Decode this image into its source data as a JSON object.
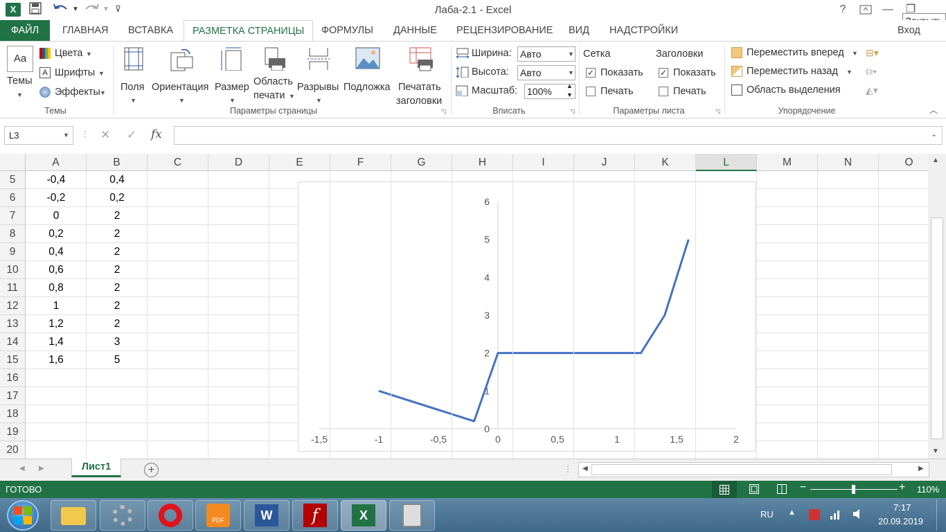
{
  "window": {
    "title": "Лаба-2.1 - Excel",
    "help": "?",
    "tooltip": "Закрыть",
    "login": "Вход"
  },
  "tabs": [
    {
      "label": "ФАЙЛ"
    },
    {
      "label": "ГЛАВНАЯ"
    },
    {
      "label": "ВСТАВКА"
    },
    {
      "label": "РАЗМЕТКА СТРАНИЦЫ"
    },
    {
      "label": "ФОРМУЛЫ"
    },
    {
      "label": "ДАННЫЕ"
    },
    {
      "label": "РЕЦЕНЗИРОВАНИЕ"
    },
    {
      "label": "ВИД"
    },
    {
      "label": "НАДСТРОЙКИ"
    }
  ],
  "ribbon": {
    "themes": {
      "label": "Темы",
      "colors": "Цвета",
      "fonts": "Шрифты",
      "effects": "Эффекты",
      "group": "Темы"
    },
    "page_setup": {
      "margins": "Поля",
      "orientation": "Ориентация",
      "size": "Размер",
      "print_area_1": "Область",
      "print_area_2": "печати",
      "breaks": "Разрывы",
      "background": "Подложка",
      "print_titles_1": "Печатать",
      "print_titles_2": "заголовки",
      "group": "Параметры страницы"
    },
    "fit": {
      "width_label": "Ширина:",
      "width_value": "Авто",
      "height_label": "Высота:",
      "height_value": "Авто",
      "scale_label": "Масштаб:",
      "scale_value": "100%",
      "group": "Вписать"
    },
    "sheet_options": {
      "gridlines": "Сетка",
      "headings": "Заголовки",
      "show": "Показать",
      "print": "Печать",
      "group": "Параметры листа"
    },
    "arrange": {
      "bring_forward": "Переместить вперед",
      "send_backward": "Переместить назад",
      "selection_pane": "Область выделения",
      "group": "Упорядочение"
    }
  },
  "formula_bar": {
    "name_box": "L3",
    "fx": "fx",
    "formula": ""
  },
  "columns": [
    "A",
    "B",
    "C",
    "D",
    "E",
    "F",
    "G",
    "H",
    "I",
    "J",
    "K",
    "L",
    "M",
    "N",
    "O"
  ],
  "active_column": "L",
  "rows": [
    {
      "n": "5",
      "a": "-0,4",
      "b": "0,4"
    },
    {
      "n": "6",
      "a": "-0,2",
      "b": "0,2"
    },
    {
      "n": "7",
      "a": "0",
      "b": "2"
    },
    {
      "n": "8",
      "a": "0,2",
      "b": "2"
    },
    {
      "n": "9",
      "a": "0,4",
      "b": "2"
    },
    {
      "n": "10",
      "a": "0,6",
      "b": "2"
    },
    {
      "n": "11",
      "a": "0,8",
      "b": "2"
    },
    {
      "n": "12",
      "a": "1",
      "b": "2"
    },
    {
      "n": "13",
      "a": "1,2",
      "b": "2"
    },
    {
      "n": "14",
      "a": "1,4",
      "b": "3"
    },
    {
      "n": "15",
      "a": "1,6",
      "b": "5"
    },
    {
      "n": "16",
      "a": "",
      "b": ""
    },
    {
      "n": "17",
      "a": "",
      "b": ""
    },
    {
      "n": "18",
      "a": "",
      "b": ""
    },
    {
      "n": "19",
      "a": "",
      "b": ""
    },
    {
      "n": "20",
      "a": "",
      "b": ""
    }
  ],
  "chart_data": {
    "type": "scatter",
    "title": "",
    "xlabel": "",
    "ylabel": "",
    "xlim": [
      -1.5,
      2
    ],
    "ylim": [
      0,
      6
    ],
    "x_ticks": [
      "-1,5",
      "-1",
      "-0,5",
      "0",
      "0,5",
      "1",
      "1,5",
      "2"
    ],
    "y_ticks": [
      "0",
      "1",
      "2",
      "3",
      "4",
      "5",
      "6"
    ],
    "grid": false,
    "line_color": "#4472C4",
    "series": [
      {
        "x": [
          -1,
          -0.2,
          0,
          0.2,
          0.4,
          0.6,
          0.8,
          1,
          1.2,
          1.4,
          1.6
        ],
        "y": [
          1,
          0.2,
          2,
          2,
          2,
          2,
          2,
          2,
          2,
          3,
          5
        ]
      }
    ]
  },
  "sheets": [
    {
      "label": "Лист1"
    }
  ],
  "status": {
    "text": "ГОТОВО",
    "zoom": "110%"
  },
  "taskbar": {
    "lang": "RU",
    "time": "7:17",
    "date": "20.09.2019"
  },
  "colors": {
    "excel_green": "#217346"
  }
}
